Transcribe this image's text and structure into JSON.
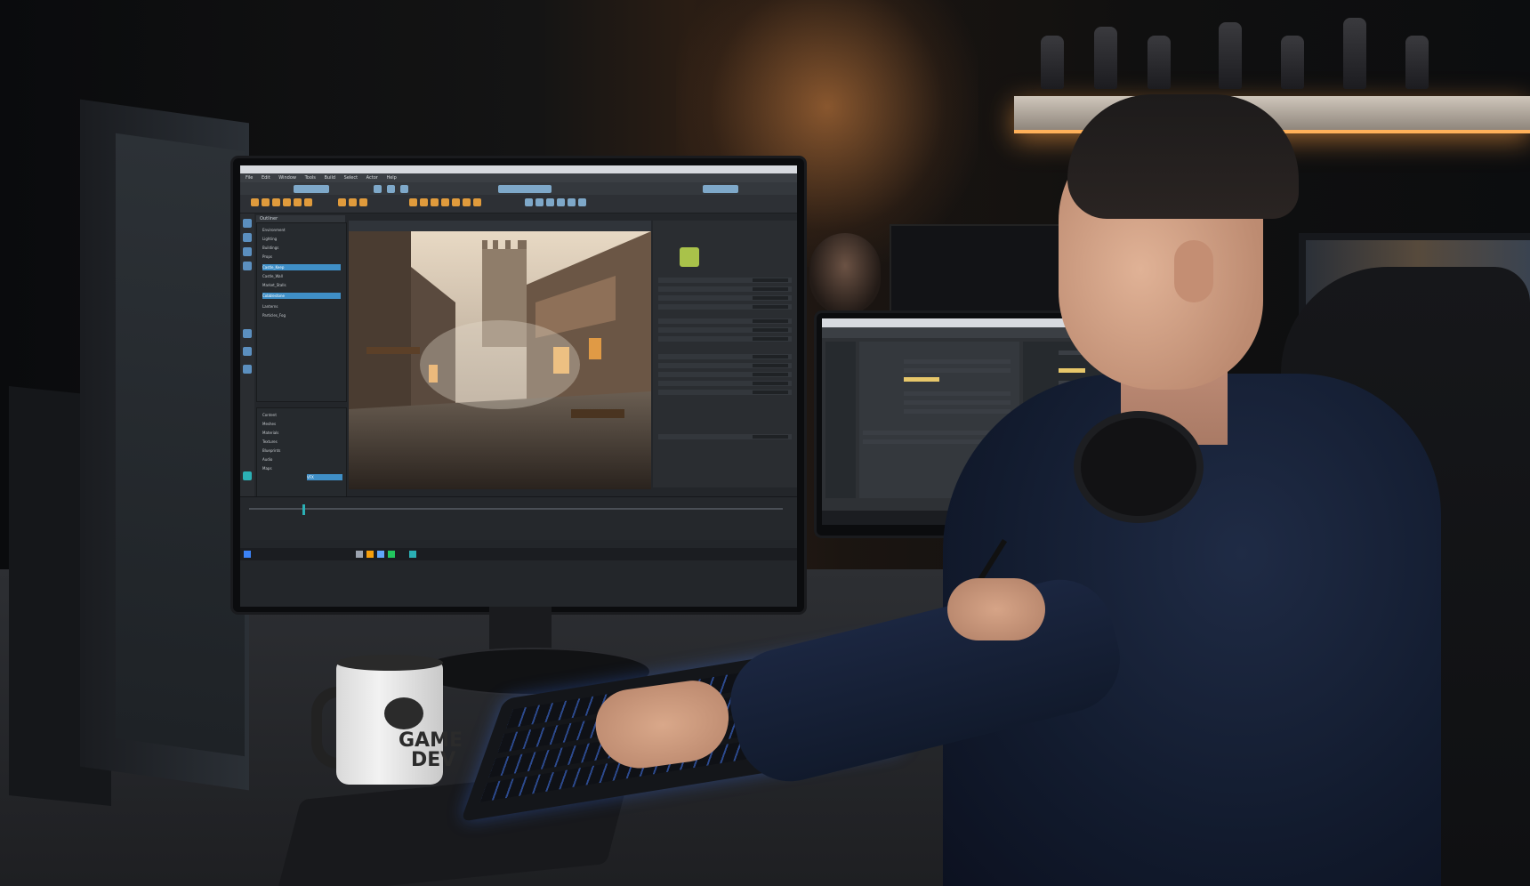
{
  "scene": {
    "description_tags": [
      "game-dev-workstation",
      "3d-editor",
      "monitor",
      "keyboard",
      "mug",
      "person"
    ]
  },
  "mug": {
    "text_line1": "GAME",
    "text_line2": "DEV"
  },
  "editor": {
    "menu": [
      "File",
      "Edit",
      "Window",
      "Tools",
      "Build",
      "Select",
      "Actor",
      "Help"
    ],
    "outliner_rows": [
      "Outliner",
      "Environment",
      "Lighting",
      "Buildings",
      "Props",
      "Castle_Keep",
      "Castle_Wall",
      "Market_Stalls",
      "Cobblestone",
      "Lanterns",
      "Particles_Fog"
    ],
    "content_rows": [
      "Content",
      "Meshes",
      "Materials",
      "Textures",
      "Blueprints",
      "Audio",
      "Maps",
      "VFX"
    ]
  },
  "colors": {
    "accent_orange": "#e09b3c",
    "selection_blue": "#3f8fc7",
    "keyboard_glow": "#2c4a8f",
    "shelf_light": "#ffb15a"
  }
}
